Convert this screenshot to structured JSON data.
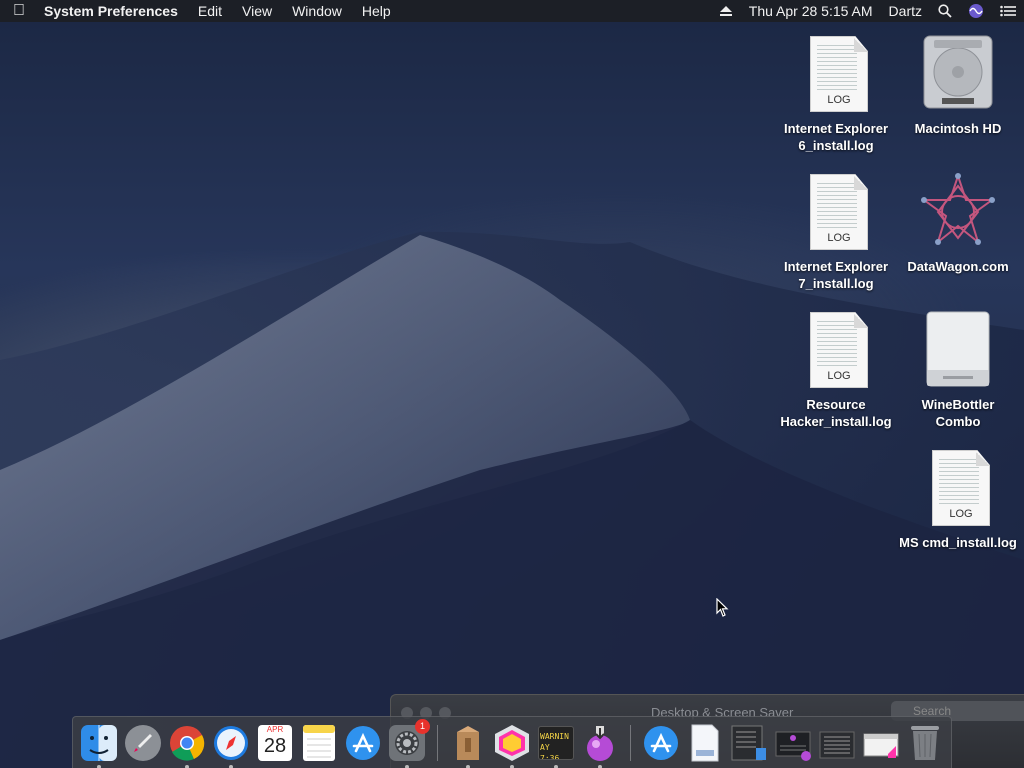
{
  "menubar": {
    "app_name": "System Preferences",
    "menus": [
      "Edit",
      "View",
      "Window",
      "Help"
    ],
    "datetime": "Thu Apr 28  5:15 AM",
    "user": "Dartz"
  },
  "desktop_icons": [
    {
      "label": "Internet Explorer 6_install.log",
      "type": "log",
      "tag": "LOG"
    },
    {
      "label": "Macintosh HD",
      "type": "disk"
    },
    {
      "label": "Internet Explorer 7_install.log",
      "type": "log",
      "tag": "LOG"
    },
    {
      "label": "DataWagon.com",
      "type": "web"
    },
    {
      "label": "Resource Hacker_install.log",
      "type": "log",
      "tag": "LOG"
    },
    {
      "label": "WineBottler Combo",
      "type": "drive"
    },
    {
      "label": "MS cmd_install.log",
      "type": "log",
      "tag": "LOG"
    }
  ],
  "background_window": {
    "title": "Desktop & Screen Saver",
    "search_placeholder": "Search"
  },
  "dock": {
    "calendar_month": "APR",
    "calendar_day": "28",
    "system_prefs_badge": "1",
    "console_text": "WARNIN",
    "console_time": "AY 7:36"
  },
  "colors": {
    "menubar_bg": "#1c1e24",
    "badge": "#e8322c"
  }
}
